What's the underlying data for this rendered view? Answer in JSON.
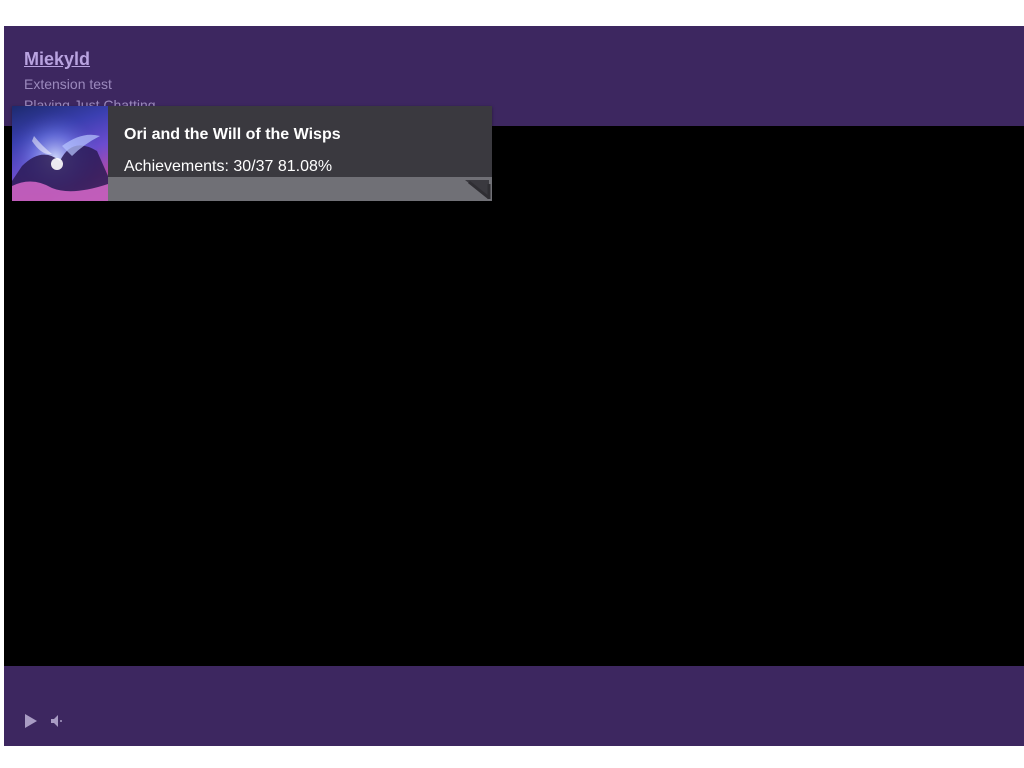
{
  "header": {
    "channel_name": "Miekyld",
    "stream_title": "Extension test",
    "stream_game": "Playing Just Chatting"
  },
  "extension": {
    "game_title": "Ori and the Will of the Wisps",
    "achievements_text": "Achievements: 30/37 81.08%",
    "achievements_unlocked": 30,
    "achievements_total": 37,
    "achievements_percent": 81.08,
    "cover_art_text": "ori"
  },
  "controls": {
    "play_icon": "play-icon",
    "volume_icon": "volume-icon"
  },
  "colors": {
    "player_purple": "#3d2760",
    "channel_link": "#b9a3e0",
    "overlay_bg": "#3a393f",
    "progress_track": "#707076"
  }
}
